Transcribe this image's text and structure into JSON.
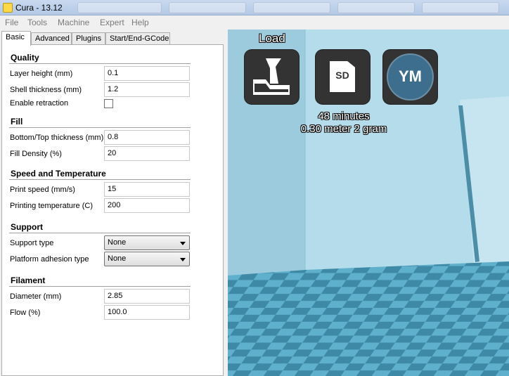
{
  "window": {
    "title": "Cura - 13.12"
  },
  "menu": [
    "File",
    "Tools",
    "Machine",
    "Expert",
    "Help"
  ],
  "tabs": [
    "Basic",
    "Advanced",
    "Plugins",
    "Start/End-GCode"
  ],
  "sections": {
    "quality": {
      "title": "Quality",
      "layer_height": {
        "label": "Layer height (mm)",
        "value": "0.1"
      },
      "shell_thickness": {
        "label": "Shell thickness (mm)",
        "value": "1.2"
      },
      "enable_retraction": {
        "label": "Enable retraction",
        "checked": false
      }
    },
    "fill": {
      "title": "Fill",
      "bottom_top_thickness": {
        "label": "Bottom/Top thickness (mm)",
        "value": "0.8"
      },
      "fill_density": {
        "label": "Fill Density (%)",
        "value": "20"
      }
    },
    "speed": {
      "title": "Speed and Temperature",
      "print_speed": {
        "label": "Print speed (mm/s)",
        "value": "15"
      },
      "printing_temperature": {
        "label": "Printing temperature (C)",
        "value": "200"
      }
    },
    "support": {
      "title": "Support",
      "support_type": {
        "label": "Support type",
        "value": "None"
      },
      "platform_adhesion": {
        "label": "Platform adhesion type",
        "value": "None"
      }
    },
    "filament": {
      "title": "Filament",
      "diameter": {
        "label": "Diameter (mm)",
        "value": "2.85"
      },
      "flow": {
        "label": "Flow (%)",
        "value": "100.0"
      }
    }
  },
  "viewport": {
    "load_label": "Load",
    "sd_label": "SD",
    "ym_label": "YM",
    "print_time": "48 minutes",
    "print_material": "0.30 meter 2 gram"
  },
  "colors": {
    "viewport_bg": "#a9d6e8",
    "platform_dark": "#3e8aa6",
    "platform_light": "#5fb0cc",
    "button_bg": "#333333",
    "ym_circle": "#3d6e8e"
  },
  "icons": [
    "app-icon",
    "load-icon",
    "sd-card-icon",
    "youmagine-icon",
    "chevron-down-icon"
  ]
}
